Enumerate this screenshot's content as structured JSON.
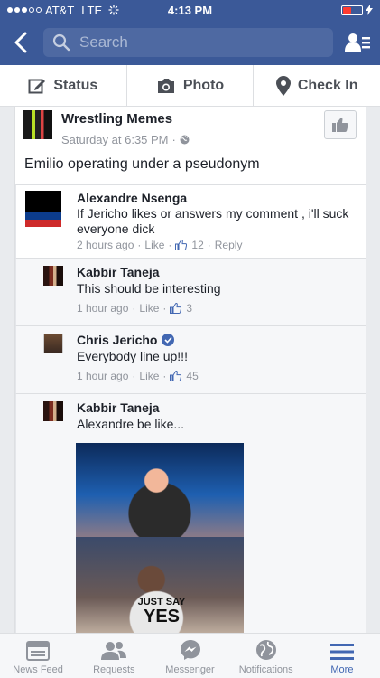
{
  "status_bar": {
    "carrier": "AT&T",
    "network": "LTE",
    "time": "4:13 PM"
  },
  "navbar": {
    "search_placeholder": "Search"
  },
  "composer": {
    "status": "Status",
    "photo": "Photo",
    "check_in": "Check In"
  },
  "post": {
    "page_name": "Wrestling Memes",
    "time": "Saturday at 6:35 PM",
    "text": "Emilio operating under a pseudonym"
  },
  "comments": [
    {
      "name": "Alexandre Nsenga",
      "text": "If Jericho likes or answers my comment , i'll suck everyone dick",
      "time": "2 hours ago",
      "like": "Like",
      "likes": "12",
      "reply": "Reply"
    },
    {
      "name": "Kabbir Taneja",
      "text": "This should be interesting",
      "time": "1 hour ago",
      "like": "Like",
      "likes": "3"
    },
    {
      "name": "Chris Jericho",
      "text": "Everybody line up!!!",
      "time": "1 hour ago",
      "like": "Like",
      "likes": "45"
    },
    {
      "name": "Kabbir Taneja",
      "text": "Alexandre be like...",
      "shirt_text": "JUST SAY",
      "shirt_text_big": "YES"
    }
  ],
  "tabs": [
    {
      "label": "News Feed"
    },
    {
      "label": "Requests"
    },
    {
      "label": "Messenger"
    },
    {
      "label": "Notifications"
    },
    {
      "label": "More"
    }
  ],
  "colors": {
    "brand": "#3b5998",
    "active_tab": "#4267b2",
    "verified": "#4267b2"
  }
}
